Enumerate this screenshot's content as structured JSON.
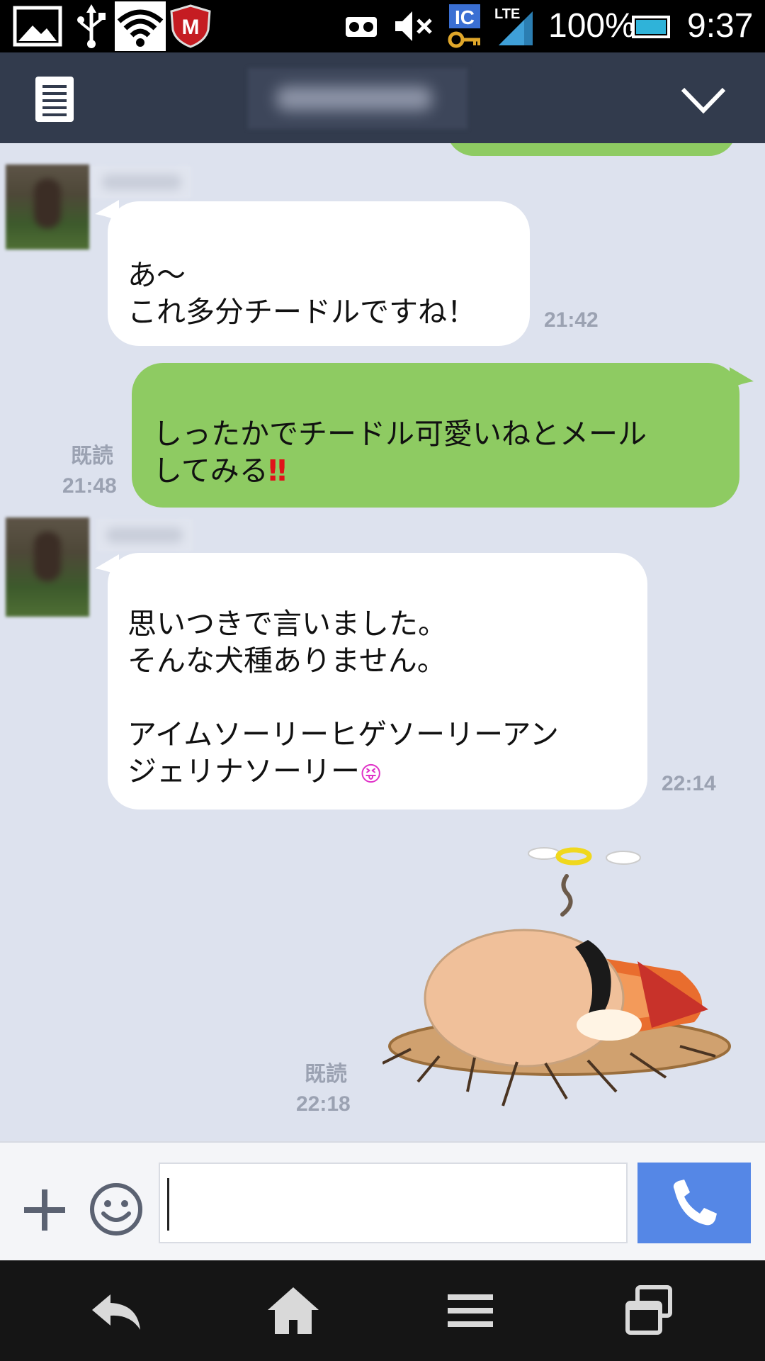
{
  "status_bar": {
    "battery": "100%",
    "time": "9:37",
    "network": "LTE",
    "ic_label": "IC",
    "mcafee_label": "M"
  },
  "header": {
    "menu_icon": "list-icon",
    "collapse_icon": "chevron-down-icon"
  },
  "messages": [
    {
      "direction": "incoming",
      "text": "あ〜\nこれ多分チードルですね！",
      "time": "21:42"
    },
    {
      "direction": "outgoing",
      "text": "しったかでチードル可愛いねとメール\nしてみる",
      "emoji": "‼",
      "read_label": "既読",
      "time": "21:48"
    },
    {
      "direction": "incoming",
      "text": "思いつきで言いました。\nそんな犬種ありません。\n\nアイムソーリーヒゲソーリーアン\nジェリナソーリー",
      "emoji": "😝",
      "time": "22:14"
    },
    {
      "direction": "outgoing",
      "type": "sticker",
      "sticker": "fallen-angel-sticker",
      "read_label": "既読",
      "time": "22:18"
    }
  ],
  "input_bar": {
    "value": "",
    "plus_icon": "plus-icon",
    "emoji_icon": "smiley-icon",
    "call_icon": "phone-icon"
  },
  "nav_bar": {
    "icons": [
      "back-icon",
      "home-icon",
      "menu-icon",
      "recent-apps-icon"
    ]
  },
  "colors": {
    "chat_background": "#dde2ee",
    "header": "#323b4d",
    "outgoing_bubble": "#8ecb62",
    "incoming_bubble": "#ffffff",
    "call_button": "#5587e6",
    "meta_text": "#9ba2b2"
  }
}
